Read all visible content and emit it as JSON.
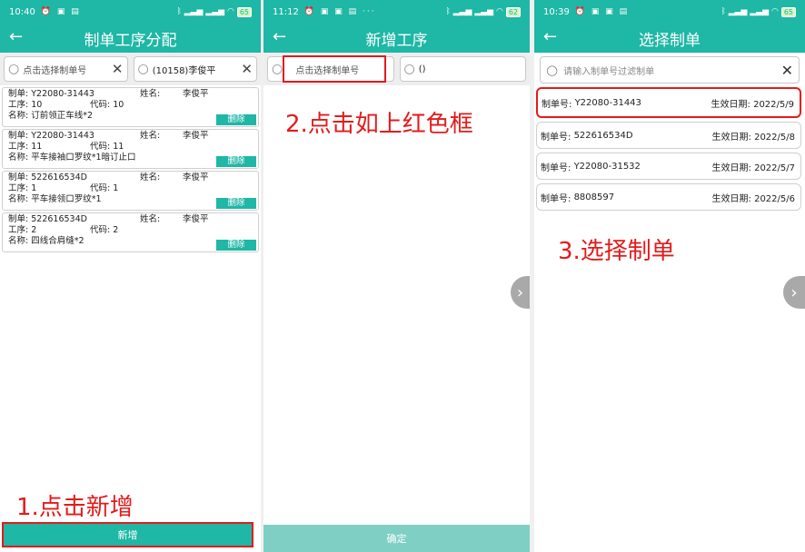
{
  "screen1": {
    "status": {
      "time": "10:40",
      "battery": "65"
    },
    "title": "制单工序分配",
    "search_order_placeholder": "点击选择制单号",
    "search_person_value": "(10158)李俊平",
    "cards": [
      {
        "order_label": "制单:",
        "order": "Y22080-31443",
        "name_label": "姓名:",
        "name": "李俊平",
        "proc_label": "工序:",
        "proc": "10",
        "code_label": "代码:",
        "code": "10",
        "pname_label": "名称:",
        "pname": "订前领正车线*2",
        "delete": "删除"
      },
      {
        "order_label": "制单:",
        "order": "Y22080-31443",
        "name_label": "姓名:",
        "name": "李俊平",
        "proc_label": "工序:",
        "proc": "11",
        "code_label": "代码:",
        "code": "11",
        "pname_label": "名称:",
        "pname": "平车接袖口罗纹*1暗订止口",
        "delete": "删除"
      },
      {
        "order_label": "制单:",
        "order": "522616534D",
        "name_label": "姓名:",
        "name": "李俊平",
        "proc_label": "工序:",
        "proc": "1",
        "code_label": "代码:",
        "code": "1",
        "pname_label": "名称:",
        "pname": "平车接领口罗纹*1",
        "delete": "删除"
      },
      {
        "order_label": "制单:",
        "order": "522616534D",
        "name_label": "姓名:",
        "name": "李俊平",
        "proc_label": "工序:",
        "proc": "2",
        "code_label": "代码:",
        "code": "2",
        "pname_label": "名称:",
        "pname": "四线合肩缝*2",
        "delete": "删除"
      }
    ],
    "add_button": "新增",
    "annotation": "1.点击新增"
  },
  "screen2": {
    "status": {
      "time": "11:12",
      "battery": "62"
    },
    "title": "新增工序",
    "search_order_placeholder": "点击选择制单号",
    "search_person_value": "()",
    "confirm_button": "确定",
    "annotation": "2.点击如上红色框"
  },
  "screen3": {
    "status": {
      "time": "10:39",
      "battery": "65"
    },
    "title": "选择制单",
    "filter_placeholder": "请输入制单号过滤制单",
    "orders": [
      {
        "label": "制单号:",
        "no": "Y22080-31443",
        "date_label": "生效日期:",
        "date": "2022/5/9"
      },
      {
        "label": "制单号:",
        "no": "522616534D",
        "date_label": "生效日期:",
        "date": "2022/5/8"
      },
      {
        "label": "制单号:",
        "no": "Y22080-31532",
        "date_label": "生效日期:",
        "date": "2022/5/7"
      },
      {
        "label": "制单号:",
        "no": "8808597",
        "date_label": "生效日期:",
        "date": "2022/5/6"
      }
    ],
    "annotation": "3.选择制单"
  },
  "colors": {
    "accent": "#1fb7a5",
    "annotation": "#e31b1b"
  },
  "icons": {
    "back": "arrow-left-icon",
    "search": "magnifier-icon",
    "clear": "close-icon",
    "next": "chevron-right-icon"
  }
}
